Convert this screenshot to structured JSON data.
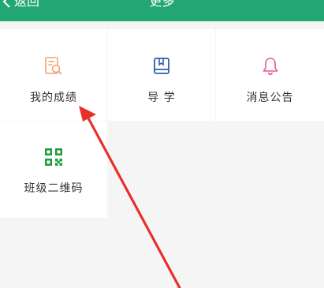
{
  "header": {
    "back_label": "返回",
    "title": "更多",
    "bg_color": "#22a672"
  },
  "tiles": [
    {
      "label": "我的成绩",
      "icon": "report-search-icon",
      "color": "#f2a36b"
    },
    {
      "label": "导 学",
      "icon": "book-icon",
      "color": "#2f5fa8"
    },
    {
      "label": "消息公告",
      "icon": "bell-icon",
      "color": "#e4579b"
    },
    {
      "label": "班级二维码",
      "icon": "qr-code-icon",
      "color": "#1e9c3e"
    }
  ],
  "annotation": {
    "icon": "red-arrow",
    "color": "#e8302b"
  }
}
